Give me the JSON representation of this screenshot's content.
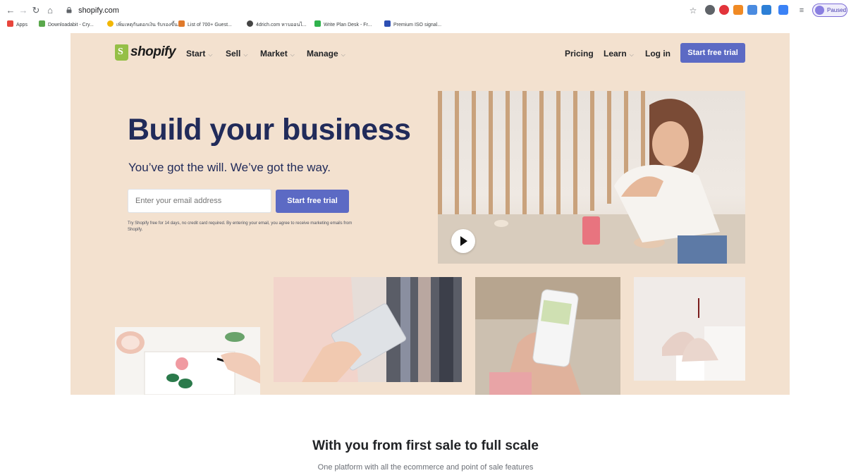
{
  "browser": {
    "url": "shopify.com",
    "profile_status": "Paused",
    "bookmarks": [
      {
        "label": "Apps",
        "color": "#e8453c"
      },
      {
        "label": "Downloadabit - Cry...",
        "color": "#5aa84c"
      },
      {
        "label": "เพิ่มเหตุกันดอกเงิน รับรองขึ้น...",
        "color": "#f2b705"
      },
      {
        "label": "List of 700+ Guest...",
        "color": "#e07a2b"
      },
      {
        "label": "4drich.com หาบออนไ...",
        "color": "#444444"
      },
      {
        "label": "Write Plan Desk - Fr...",
        "color": "#2fb24c"
      },
      {
        "label": "Premium ISO signal...",
        "color": "#2d4fb3"
      }
    ]
  },
  "header": {
    "brand": "shopify",
    "nav_left": [
      "Start",
      "Sell",
      "Market",
      "Manage"
    ],
    "nav_right": {
      "pricing": "Pricing",
      "learn": "Learn",
      "login": "Log in"
    },
    "cta": "Start free trial"
  },
  "hero": {
    "title": "Build your business",
    "subtitle": "You’ve got the will. We’ve got the way.",
    "email_placeholder": "Enter your email address",
    "cta": "Start free trial",
    "legal": "Try Shopify free for 14 days, no credit card required. By entering your email, you agree to receive marketing emails from Shopify."
  },
  "section": {
    "title": "With you from first sale to full scale",
    "subtitle": "One platform with all the ecommerce and point of sale features"
  },
  "colors": {
    "hero_bg": "#f3e1cf",
    "accent": "#5c6ac4",
    "heading": "#212b5a"
  }
}
